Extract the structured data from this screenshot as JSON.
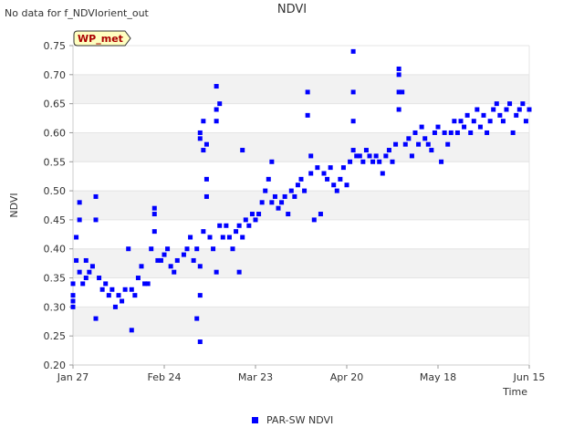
{
  "message": "No data for f_NDVIorient_out",
  "badge": "WP_met",
  "chart_data": {
    "type": "scatter",
    "title": "NDVI",
    "xlabel": "Time",
    "ylabel": "NDVI",
    "x_range": [
      "2024-01-27",
      "2024-06-15"
    ],
    "x_ticks": [
      {
        "date": "2024-01-27",
        "label": "Jan 27"
      },
      {
        "date": "2024-02-24",
        "label": "Feb 24"
      },
      {
        "date": "2024-03-23",
        "label": "Mar 23"
      },
      {
        "date": "2024-04-20",
        "label": "Apr 20"
      },
      {
        "date": "2024-05-18",
        "label": "May 18"
      },
      {
        "date": "2024-06-15",
        "label": "Jun 15"
      }
    ],
    "ylim": [
      0.2,
      0.75
    ],
    "y_ticks": [
      "0.20",
      "0.25",
      "0.30",
      "0.35",
      "0.40",
      "0.45",
      "0.50",
      "0.55",
      "0.60",
      "0.65",
      "0.70",
      "0.75"
    ],
    "grid": "horizontal-bands",
    "legend_position": "bottom-center",
    "series": [
      {
        "name": "PAR-SW NDVI",
        "color": "#0000ff",
        "points": [
          [
            "2024-01-27",
            0.3
          ],
          [
            "2024-01-27",
            0.31
          ],
          [
            "2024-01-27",
            0.32
          ],
          [
            "2024-01-27",
            0.34
          ],
          [
            "2024-01-28",
            0.38
          ],
          [
            "2024-01-28",
            0.42
          ],
          [
            "2024-01-29",
            0.36
          ],
          [
            "2024-01-29",
            0.48
          ],
          [
            "2024-01-29",
            0.45
          ],
          [
            "2024-01-30",
            0.34
          ],
          [
            "2024-01-31",
            0.38
          ],
          [
            "2024-01-31",
            0.35
          ],
          [
            "2024-02-01",
            0.36
          ],
          [
            "2024-02-02",
            0.37
          ],
          [
            "2024-02-03",
            0.49
          ],
          [
            "2024-02-03",
            0.45
          ],
          [
            "2024-02-03",
            0.28
          ],
          [
            "2024-02-04",
            0.35
          ],
          [
            "2024-02-05",
            0.33
          ],
          [
            "2024-02-06",
            0.34
          ],
          [
            "2024-02-07",
            0.32
          ],
          [
            "2024-02-08",
            0.33
          ],
          [
            "2024-02-09",
            0.3
          ],
          [
            "2024-02-10",
            0.32
          ],
          [
            "2024-02-11",
            0.31
          ],
          [
            "2024-02-12",
            0.33
          ],
          [
            "2024-02-13",
            0.4
          ],
          [
            "2024-02-14",
            0.33
          ],
          [
            "2024-02-14",
            0.26
          ],
          [
            "2024-02-15",
            0.32
          ],
          [
            "2024-02-16",
            0.35
          ],
          [
            "2024-02-17",
            0.37
          ],
          [
            "2024-02-18",
            0.34
          ],
          [
            "2024-02-19",
            0.34
          ],
          [
            "2024-02-20",
            0.4
          ],
          [
            "2024-02-21",
            0.47
          ],
          [
            "2024-02-21",
            0.46
          ],
          [
            "2024-02-21",
            0.43
          ],
          [
            "2024-02-22",
            0.38
          ],
          [
            "2024-02-23",
            0.38
          ],
          [
            "2024-02-24",
            0.39
          ],
          [
            "2024-02-25",
            0.4
          ],
          [
            "2024-02-26",
            0.37
          ],
          [
            "2024-02-27",
            0.36
          ],
          [
            "2024-02-28",
            0.38
          ],
          [
            "2024-03-01",
            0.39
          ],
          [
            "2024-03-02",
            0.4
          ],
          [
            "2024-03-03",
            0.42
          ],
          [
            "2024-03-04",
            0.38
          ],
          [
            "2024-03-05",
            0.4
          ],
          [
            "2024-03-05",
            0.28
          ],
          [
            "2024-03-06",
            0.24
          ],
          [
            "2024-03-06",
            0.32
          ],
          [
            "2024-03-06",
            0.37
          ],
          [
            "2024-03-06",
            0.59
          ],
          [
            "2024-03-06",
            0.6
          ],
          [
            "2024-03-07",
            0.62
          ],
          [
            "2024-03-07",
            0.57
          ],
          [
            "2024-03-07",
            0.43
          ],
          [
            "2024-03-08",
            0.58
          ],
          [
            "2024-03-08",
            0.52
          ],
          [
            "2024-03-08",
            0.49
          ],
          [
            "2024-03-09",
            0.42
          ],
          [
            "2024-03-10",
            0.4
          ],
          [
            "2024-03-11",
            0.36
          ],
          [
            "2024-03-11",
            0.62
          ],
          [
            "2024-03-11",
            0.64
          ],
          [
            "2024-03-11",
            0.68
          ],
          [
            "2024-03-12",
            0.65
          ],
          [
            "2024-03-12",
            0.44
          ],
          [
            "2024-03-13",
            0.42
          ],
          [
            "2024-03-14",
            0.44
          ],
          [
            "2024-03-15",
            0.42
          ],
          [
            "2024-03-16",
            0.4
          ],
          [
            "2024-03-17",
            0.43
          ],
          [
            "2024-03-18",
            0.44
          ],
          [
            "2024-03-18",
            0.36
          ],
          [
            "2024-03-19",
            0.42
          ],
          [
            "2024-03-19",
            0.57
          ],
          [
            "2024-03-20",
            0.45
          ],
          [
            "2024-03-21",
            0.44
          ],
          [
            "2024-03-22",
            0.46
          ],
          [
            "2024-03-23",
            0.45
          ],
          [
            "2024-03-24",
            0.46
          ],
          [
            "2024-03-25",
            0.48
          ],
          [
            "2024-03-26",
            0.5
          ],
          [
            "2024-03-27",
            0.52
          ],
          [
            "2024-03-28",
            0.48
          ],
          [
            "2024-03-28",
            0.55
          ],
          [
            "2024-03-29",
            0.49
          ],
          [
            "2024-03-30",
            0.47
          ],
          [
            "2024-03-31",
            0.48
          ],
          [
            "2024-04-01",
            0.49
          ],
          [
            "2024-04-02",
            0.46
          ],
          [
            "2024-04-03",
            0.5
          ],
          [
            "2024-04-04",
            0.49
          ],
          [
            "2024-04-05",
            0.51
          ],
          [
            "2024-04-06",
            0.52
          ],
          [
            "2024-04-07",
            0.5
          ],
          [
            "2024-04-08",
            0.67
          ],
          [
            "2024-04-08",
            0.63
          ],
          [
            "2024-04-09",
            0.56
          ],
          [
            "2024-04-09",
            0.53
          ],
          [
            "2024-04-10",
            0.45
          ],
          [
            "2024-04-11",
            0.54
          ],
          [
            "2024-04-12",
            0.46
          ],
          [
            "2024-04-13",
            0.53
          ],
          [
            "2024-04-14",
            0.52
          ],
          [
            "2024-04-15",
            0.54
          ],
          [
            "2024-04-16",
            0.51
          ],
          [
            "2024-04-17",
            0.5
          ],
          [
            "2024-04-18",
            0.52
          ],
          [
            "2024-04-19",
            0.54
          ],
          [
            "2024-04-20",
            0.51
          ],
          [
            "2024-04-21",
            0.55
          ],
          [
            "2024-04-22",
            0.57
          ],
          [
            "2024-04-22",
            0.67
          ],
          [
            "2024-04-22",
            0.74
          ],
          [
            "2024-04-22",
            0.62
          ],
          [
            "2024-04-23",
            0.56
          ],
          [
            "2024-04-24",
            0.56
          ],
          [
            "2024-04-25",
            0.55
          ],
          [
            "2024-04-26",
            0.57
          ],
          [
            "2024-04-27",
            0.56
          ],
          [
            "2024-04-28",
            0.55
          ],
          [
            "2024-04-29",
            0.56
          ],
          [
            "2024-04-30",
            0.55
          ],
          [
            "2024-05-01",
            0.53
          ],
          [
            "2024-05-02",
            0.56
          ],
          [
            "2024-05-03",
            0.57
          ],
          [
            "2024-05-04",
            0.55
          ],
          [
            "2024-05-05",
            0.58
          ],
          [
            "2024-05-06",
            0.71
          ],
          [
            "2024-05-06",
            0.7
          ],
          [
            "2024-05-06",
            0.67
          ],
          [
            "2024-05-06",
            0.64
          ],
          [
            "2024-05-07",
            0.67
          ],
          [
            "2024-05-08",
            0.58
          ],
          [
            "2024-05-09",
            0.59
          ],
          [
            "2024-05-10",
            0.56
          ],
          [
            "2024-05-11",
            0.6
          ],
          [
            "2024-05-12",
            0.58
          ],
          [
            "2024-05-13",
            0.61
          ],
          [
            "2024-05-14",
            0.59
          ],
          [
            "2024-05-15",
            0.58
          ],
          [
            "2024-05-16",
            0.57
          ],
          [
            "2024-05-17",
            0.6
          ],
          [
            "2024-05-18",
            0.61
          ],
          [
            "2024-05-19",
            0.55
          ],
          [
            "2024-05-20",
            0.6
          ],
          [
            "2024-05-21",
            0.58
          ],
          [
            "2024-05-22",
            0.6
          ],
          [
            "2024-05-23",
            0.62
          ],
          [
            "2024-05-24",
            0.6
          ],
          [
            "2024-05-25",
            0.62
          ],
          [
            "2024-05-26",
            0.61
          ],
          [
            "2024-05-27",
            0.63
          ],
          [
            "2024-05-28",
            0.6
          ],
          [
            "2024-05-29",
            0.62
          ],
          [
            "2024-05-30",
            0.64
          ],
          [
            "2024-05-31",
            0.61
          ],
          [
            "2024-06-01",
            0.63
          ],
          [
            "2024-06-02",
            0.6
          ],
          [
            "2024-06-03",
            0.62
          ],
          [
            "2024-06-04",
            0.64
          ],
          [
            "2024-06-05",
            0.65
          ],
          [
            "2024-06-06",
            0.63
          ],
          [
            "2024-06-07",
            0.62
          ],
          [
            "2024-06-08",
            0.64
          ],
          [
            "2024-06-09",
            0.65
          ],
          [
            "2024-06-10",
            0.6
          ],
          [
            "2024-06-11",
            0.63
          ],
          [
            "2024-06-12",
            0.64
          ],
          [
            "2024-06-13",
            0.65
          ],
          [
            "2024-06-14",
            0.62
          ],
          [
            "2024-06-15",
            0.64
          ]
        ]
      }
    ]
  }
}
